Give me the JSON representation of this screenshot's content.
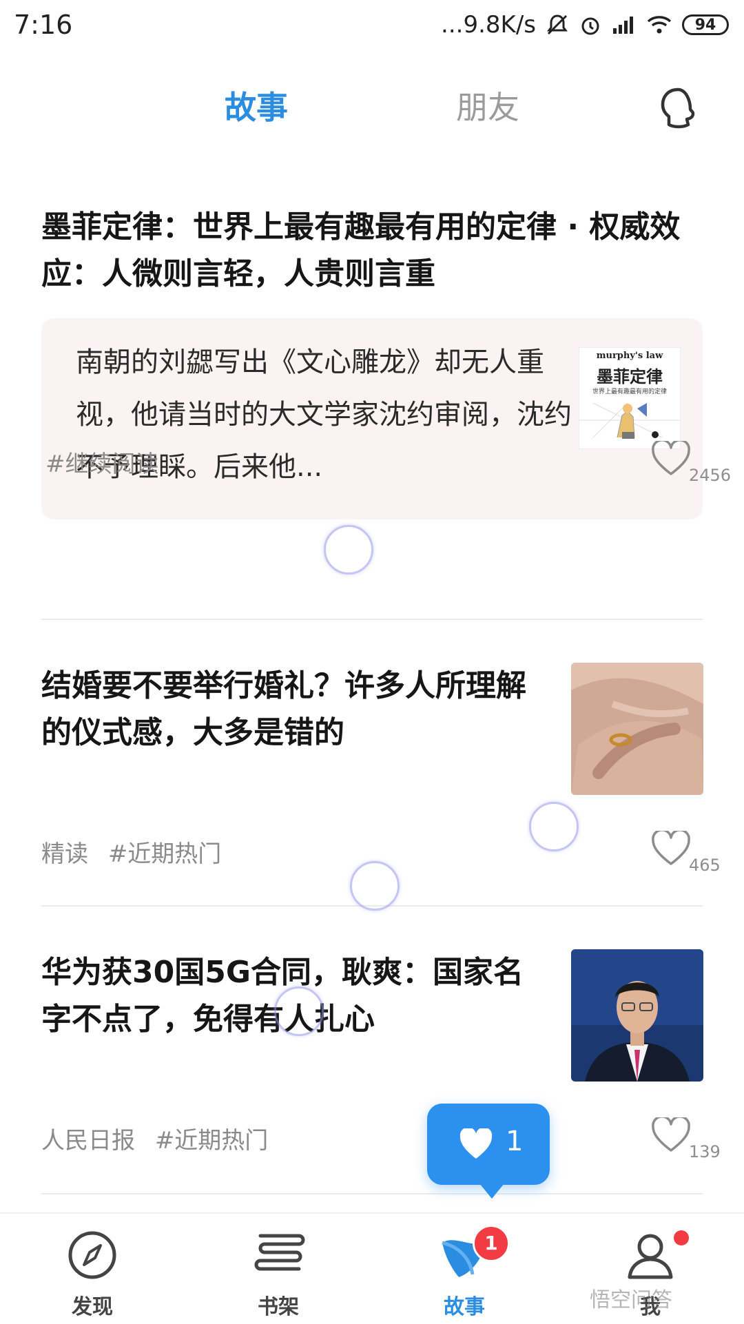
{
  "status_bar": {
    "time": "7:16",
    "network_speed": "...9.8K/s",
    "battery": "94",
    "icons": [
      "mute-bell-icon",
      "alarm-icon",
      "signal-icon",
      "wifi-icon",
      "battery-icon"
    ]
  },
  "top_tabs": {
    "story": "故事",
    "friends": "朋友",
    "profile_icon": "profile-head-icon",
    "active_color": "#2a8de0"
  },
  "articles": [
    {
      "title": "墨菲定律：世界上最有趣最有用的定律 · 权威效应：人微则言轻，人贵则言重",
      "excerpt": "南朝的刘勰写出《文心雕龙》却无人重视，他请当时的大文学家沈约审阅，沈约不予理睬。后来他...",
      "thumb_label_en": "murphy's law",
      "thumb_label_cn": "墨菲定律",
      "thumb_subtitle": "世界上最有趣最有用的定律",
      "tags": [
        "#继续阅读"
      ],
      "likes": "2456"
    },
    {
      "title": "结婚要不要举行婚礼？许多人所理解的仪式感，大多是错的",
      "tags": [
        "精读",
        "#近期热门"
      ],
      "likes": "465",
      "image": "hands-with-ring-photo"
    },
    {
      "title": "华为获30国5G合同，耿爽：国家名字不点了，免得有人扎心",
      "tags": [
        "人民日报",
        "#近期热门"
      ],
      "likes": "139",
      "image": "spokesman-photo"
    }
  ],
  "like_popup": {
    "count": "1"
  },
  "bottom_nav": [
    {
      "label": "发现",
      "icon": "compass-icon"
    },
    {
      "label": "书架",
      "icon": "bookshelf-icon"
    },
    {
      "label": "故事",
      "icon": "story-icon",
      "badge": "1",
      "active": true
    },
    {
      "label": "我",
      "icon": "user-icon",
      "dot": true
    }
  ],
  "watermark": "悟空问答"
}
